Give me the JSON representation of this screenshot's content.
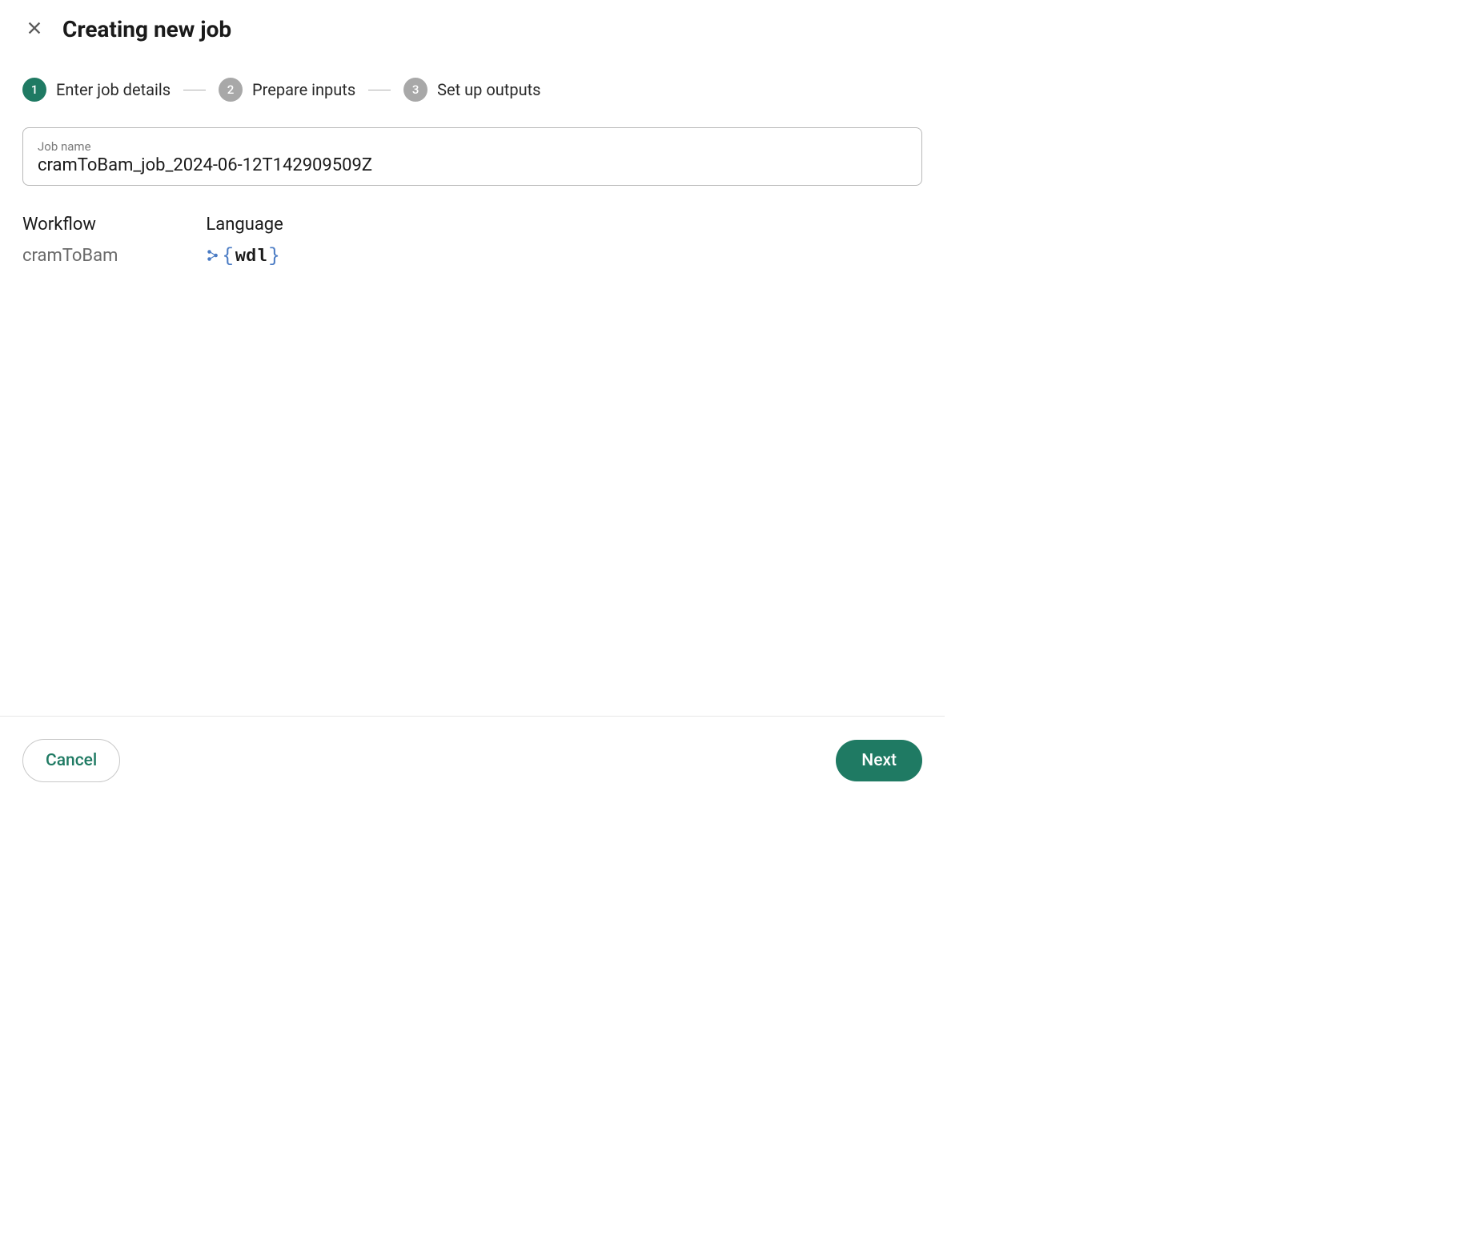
{
  "header": {
    "title": "Creating new job"
  },
  "stepper": {
    "steps": [
      {
        "num": "1",
        "label": "Enter job details",
        "active": true
      },
      {
        "num": "2",
        "label": "Prepare inputs",
        "active": false
      },
      {
        "num": "3",
        "label": "Set up outputs",
        "active": false
      }
    ]
  },
  "form": {
    "job_name_label": "Job name",
    "job_name_value": "cramToBam_job_2024-06-12T142909509Z"
  },
  "info": {
    "workflow_label": "Workflow",
    "workflow_value": "cramToBam",
    "language_label": "Language",
    "language_value": "wdl"
  },
  "footer": {
    "cancel_label": "Cancel",
    "next_label": "Next"
  }
}
